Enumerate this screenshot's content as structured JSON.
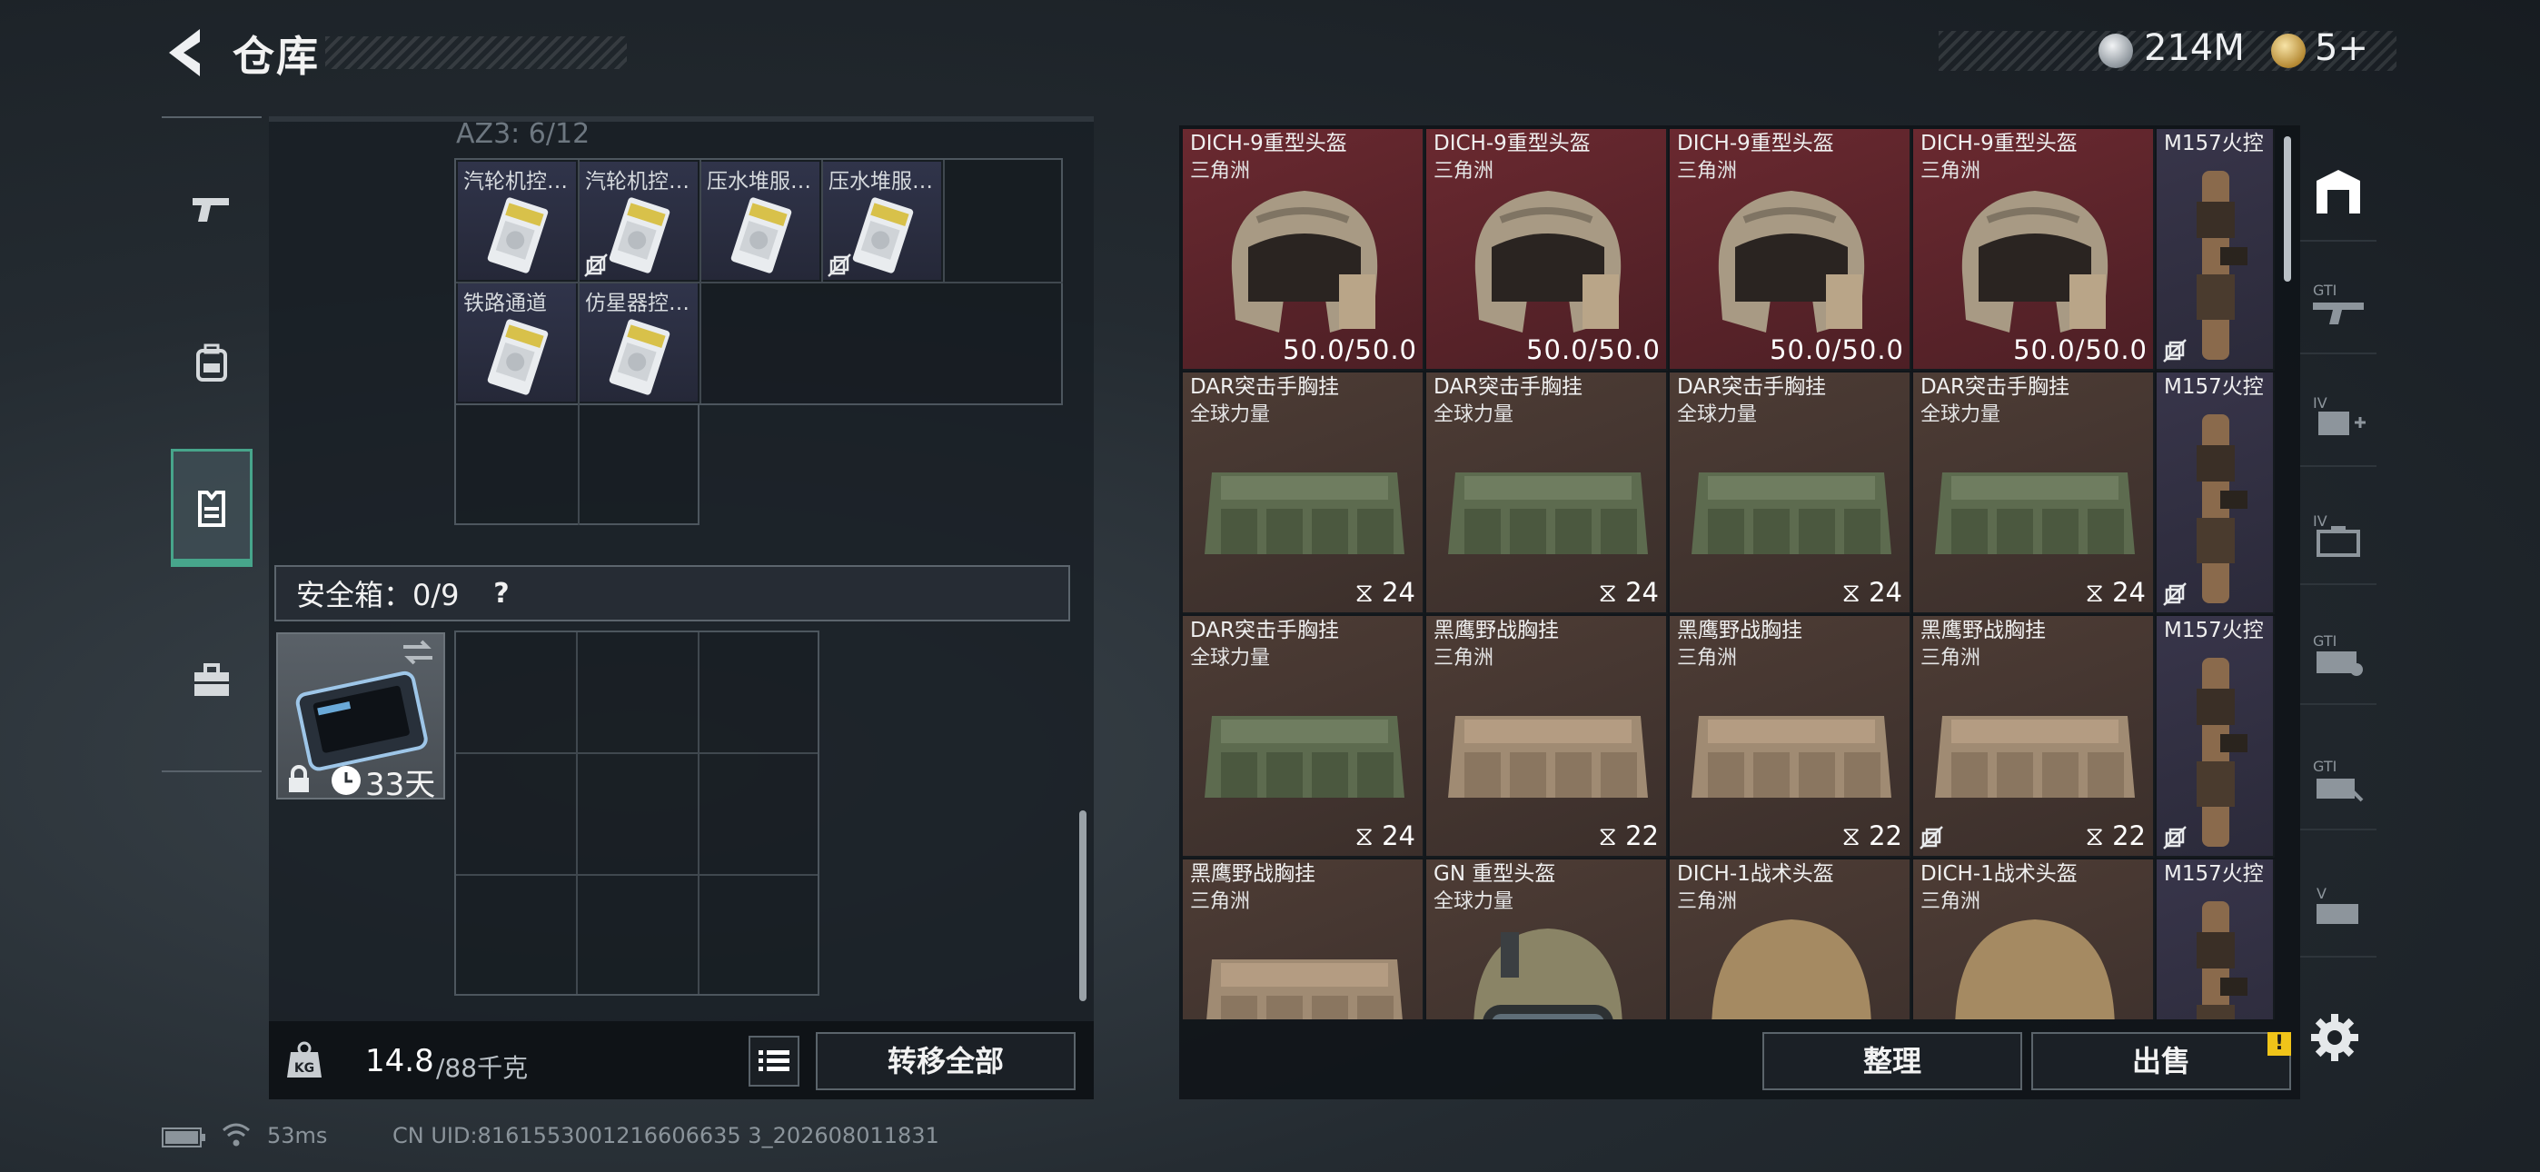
{
  "header": {
    "title": "仓库",
    "currency_silver": "214M",
    "currency_gold": "5+"
  },
  "left_rail": {
    "items": [
      {
        "name": "weapons",
        "icon": "pistol-icon"
      },
      {
        "name": "equipment",
        "icon": "backpack-icon"
      },
      {
        "name": "chest-rig",
        "icon": "vest-icon",
        "active": true
      },
      {
        "name": "supplies",
        "icon": "toolbox-icon"
      }
    ]
  },
  "container": {
    "section_label": "AZ3: 6/12",
    "items": [
      {
        "name": "汽轮机控…",
        "no_drop": false
      },
      {
        "name": "汽轮机控…",
        "no_drop": true
      },
      {
        "name": "压水堆服…",
        "no_drop": false
      },
      {
        "name": "压水堆服…",
        "no_drop": true
      },
      {
        "name": "铁路通道",
        "no_drop": false
      },
      {
        "name": "仿星器控…",
        "no_drop": false
      }
    ]
  },
  "safebox": {
    "label": "安全箱：0/9",
    "help": "?",
    "days": "33天"
  },
  "weight": {
    "current": "14.8",
    "max": "/88千克"
  },
  "buttons": {
    "transfer_all": "转移全部",
    "sort": "整理",
    "sell": "出售",
    "sell_alert": "!"
  },
  "stash": {
    "rows": [
      [
        {
          "name": "DICH-9重型头盔",
          "sub": "三角洲",
          "value": "50.0/50.0",
          "kind": "helmet-heavy",
          "color": "red"
        },
        {
          "name": "DICH-9重型头盔",
          "sub": "三角洲",
          "value": "50.0/50.0",
          "kind": "helmet-heavy",
          "color": "red"
        },
        {
          "name": "DICH-9重型头盔",
          "sub": "三角洲",
          "value": "50.0/50.0",
          "kind": "helmet-heavy",
          "color": "red"
        },
        {
          "name": "DICH-9重型头盔",
          "sub": "三角洲",
          "value": "50.0/50.0",
          "kind": "helmet-heavy",
          "color": "red"
        },
        {
          "name": "M157火控",
          "sub": "",
          "value": "",
          "kind": "scope",
          "color": "purple",
          "no_drop": true
        }
      ],
      [
        {
          "name": "DAR突击手胸挂",
          "sub": "全球力量",
          "value": "24",
          "kind": "rig-green",
          "color": "brown"
        },
        {
          "name": "DAR突击手胸挂",
          "sub": "全球力量",
          "value": "24",
          "kind": "rig-green",
          "color": "brown"
        },
        {
          "name": "DAR突击手胸挂",
          "sub": "全球力量",
          "value": "24",
          "kind": "rig-green",
          "color": "brown"
        },
        {
          "name": "DAR突击手胸挂",
          "sub": "全球力量",
          "value": "24",
          "kind": "rig-green",
          "color": "brown"
        },
        {
          "name": "M157火控",
          "sub": "",
          "value": "",
          "kind": "scope",
          "color": "purple",
          "no_drop": true
        }
      ],
      [
        {
          "name": "DAR突击手胸挂",
          "sub": "全球力量",
          "value": "24",
          "kind": "rig-green",
          "color": "brown"
        },
        {
          "name": "黑鹰野战胸挂",
          "sub": "三角洲",
          "value": "22",
          "kind": "rig-tan",
          "color": "brown"
        },
        {
          "name": "黑鹰野战胸挂",
          "sub": "三角洲",
          "value": "22",
          "kind": "rig-tan",
          "color": "brown"
        },
        {
          "name": "黑鹰野战胸挂",
          "sub": "三角洲",
          "value": "22",
          "kind": "rig-tan",
          "color": "brown",
          "no_drop": true
        },
        {
          "name": "M157火控",
          "sub": "",
          "value": "",
          "kind": "scope",
          "color": "purple",
          "no_drop": true
        }
      ],
      [
        {
          "name": "黑鹰野战胸挂",
          "sub": "三角洲",
          "value": "",
          "kind": "rig-tan",
          "color": "brown"
        },
        {
          "name": "GN 重型头盔",
          "sub": "全球力量",
          "value": "",
          "kind": "helmet-gn",
          "color": "brown"
        },
        {
          "name": "DICH-1战术头盔",
          "sub": "三角洲",
          "value": "",
          "kind": "helmet-tac",
          "color": "brown"
        },
        {
          "name": "DICH-1战术头盔",
          "sub": "三角洲",
          "value": "",
          "kind": "helmet-tac",
          "color": "brown"
        },
        {
          "name": "M157火控",
          "sub": "",
          "value": "",
          "kind": "scope",
          "color": "purple"
        }
      ]
    ]
  },
  "right_rail": {
    "items": [
      {
        "name": "all-items",
        "icon": "warehouse-icon"
      },
      {
        "name": "gti-weapons",
        "icon": "gti-weapon-icon"
      },
      {
        "name": "iv-medical",
        "icon": "iv-add-icon"
      },
      {
        "name": "iv-storage",
        "icon": "iv-case-icon"
      },
      {
        "name": "gti-case",
        "icon": "gti-case-icon"
      },
      {
        "name": "gti-hand",
        "icon": "gti-hand-icon"
      },
      {
        "name": "v-storage",
        "icon": "v-storage-icon"
      }
    ]
  },
  "footer": {
    "ping": "53ms",
    "uid": "CN UID:8161553001216606635 3_202608011831"
  }
}
